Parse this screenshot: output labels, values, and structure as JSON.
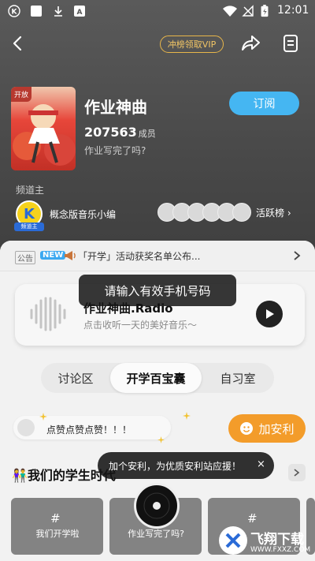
{
  "status_bar": {
    "time": "12:01"
  },
  "header": {
    "vip_label": "冲榜领取VIP"
  },
  "channel": {
    "cover_badge": "开放",
    "title": "作业神曲",
    "member_count": "207563",
    "member_unit": "成员",
    "subtitle": "作业写完了吗?",
    "subscribe_label": "订阅",
    "owner_label": "频道主",
    "owner_avatar_letter": "K",
    "owner_tag": "频道主",
    "owner_name": "概念版音乐小编",
    "active_label": "活跃榜 ›"
  },
  "announcement": {
    "tag": "公告",
    "new_tag": "NEW",
    "text": "「开学」活动获奖名单公布..."
  },
  "radio": {
    "title": "作业神曲.Radio",
    "subtitle": "点击收听一天的美好音乐～"
  },
  "toast": "请输入有效手机号码",
  "tabs": [
    {
      "label": "讨论区"
    },
    {
      "label": "开学百宝囊"
    },
    {
      "label": "自习室"
    }
  ],
  "comment": {
    "text": "点赞点赞点赞！！！"
  },
  "add_button": {
    "label": "加安利"
  },
  "tooltip": {
    "text": "加个安利，为优质安利站应援！",
    "close": "×"
  },
  "section": {
    "title": "我们的学生时代",
    "emoji": "👫"
  },
  "grid": [
    {
      "symbol": "#",
      "label": "我们开学啦"
    },
    {
      "symbol": "#",
      "label": "作业写完了吗?"
    },
    {
      "symbol": "#",
      "label": ""
    }
  ],
  "watermark": {
    "text": "飞翔下载",
    "sub": "WWW.FXXZ.COM"
  },
  "colors": {
    "accent_blue": "#45b6f2",
    "accent_orange": "#f39c2a",
    "vip_gold": "#e8b64a"
  }
}
